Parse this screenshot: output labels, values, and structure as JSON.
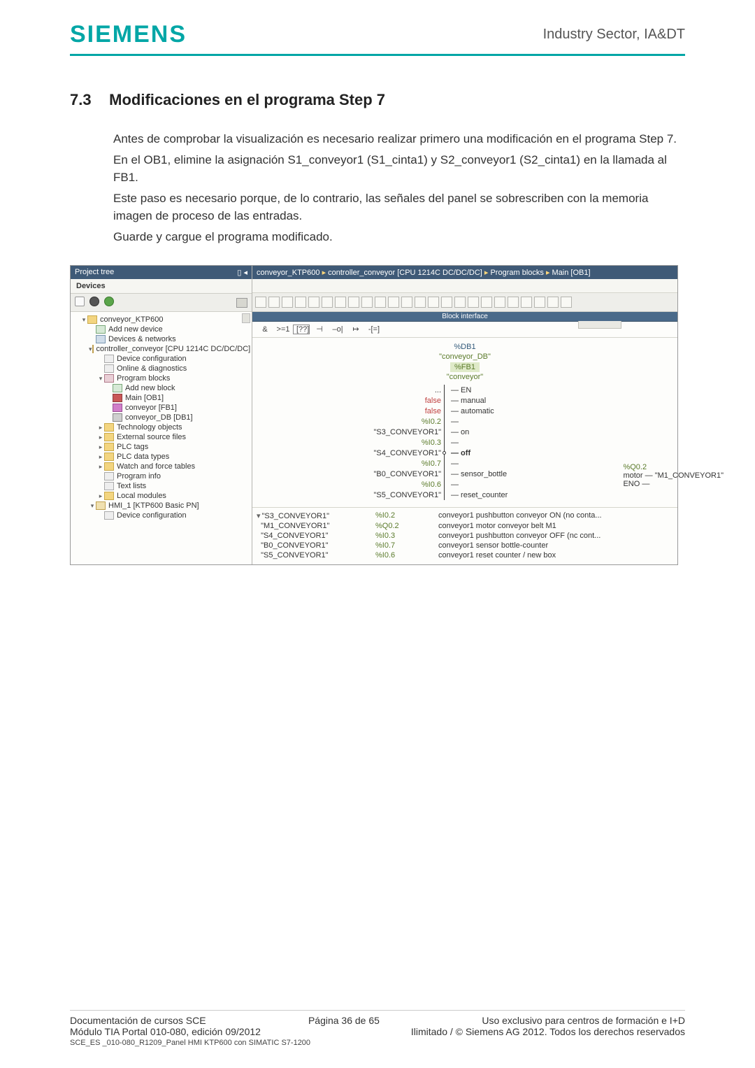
{
  "header": {
    "logo": "SIEMENS",
    "sector": "Industry Sector, IA&DT"
  },
  "section": {
    "num": "7.3",
    "title": "Modificaciones en el programa Step 7"
  },
  "body": {
    "p1": "Antes de comprobar la visualización es necesario realizar primero una modificación en el programa Step 7.",
    "p2": "En el OB1, elimine la asignación S1_conveyor1 (S1_cinta1) y S2_conveyor1 (S2_cinta1) en la llamada al FB1.",
    "p3": "Este paso es necesario porque, de lo contrario, las señales del panel se sobrescriben con la memoria imagen de proceso de las entradas.",
    "p4": "Guarde y cargue el programa modificado."
  },
  "screenshot": {
    "projectTreeTitle": "Project tree",
    "devicesTab": "Devices",
    "tree": [
      {
        "lvl": 1,
        "arrow": "▾",
        "ico": "folder",
        "label": "conveyor_KTP600"
      },
      {
        "lvl": 2,
        "arrow": "",
        "ico": "add",
        "label": "Add new device"
      },
      {
        "lvl": 2,
        "arrow": "",
        "ico": "dev",
        "label": "Devices & networks"
      },
      {
        "lvl": 2,
        "arrow": "▾",
        "ico": "plc",
        "label": "controller_conveyor [CPU 1214C DC/DC/DC]"
      },
      {
        "lvl": 3,
        "arrow": "",
        "ico": "txt",
        "label": "Device configuration"
      },
      {
        "lvl": 3,
        "arrow": "",
        "ico": "txt",
        "label": "Online & diagnostics"
      },
      {
        "lvl": 3,
        "arrow": "▾",
        "ico": "block",
        "label": "Program blocks"
      },
      {
        "lvl": 4,
        "arrow": "",
        "ico": "add",
        "label": "Add new block"
      },
      {
        "lvl": 4,
        "arrow": "",
        "ico": "main",
        "label": "Main [OB1]"
      },
      {
        "lvl": 4,
        "arrow": "",
        "ico": "fb",
        "label": "conveyor [FB1]"
      },
      {
        "lvl": 4,
        "arrow": "",
        "ico": "db",
        "label": "conveyor_DB [DB1]"
      },
      {
        "lvl": 3,
        "arrow": "▸",
        "ico": "folder",
        "label": "Technology objects"
      },
      {
        "lvl": 3,
        "arrow": "▸",
        "ico": "folder",
        "label": "External source files"
      },
      {
        "lvl": 3,
        "arrow": "▸",
        "ico": "folder",
        "label": "PLC tags"
      },
      {
        "lvl": 3,
        "arrow": "▸",
        "ico": "folder",
        "label": "PLC data types"
      },
      {
        "lvl": 3,
        "arrow": "▸",
        "ico": "folder",
        "label": "Watch and force tables"
      },
      {
        "lvl": 3,
        "arrow": "",
        "ico": "txt",
        "label": "Program info"
      },
      {
        "lvl": 3,
        "arrow": "",
        "ico": "txt",
        "label": "Text lists"
      },
      {
        "lvl": 3,
        "arrow": "▸",
        "ico": "folder",
        "label": "Local modules"
      },
      {
        "lvl": 2,
        "arrow": "▾",
        "ico": "plc",
        "label": "HMI_1 [KTP600 Basic PN]"
      },
      {
        "lvl": 3,
        "arrow": "",
        "ico": "txt",
        "label": "Device configuration"
      }
    ],
    "breadcrumb": {
      "a": "conveyor_KTP600",
      "b": "controller_conveyor [CPU 1214C DC/DC/DC]",
      "c": "Program blocks",
      "d": "Main [OB1]"
    },
    "blockInterface": "Block interface",
    "logicSymbols": [
      "&",
      ">=1",
      "[??]",
      "⊣",
      "–o|",
      "↦",
      "-[=]"
    ],
    "fbHead": {
      "db": "%DB1",
      "dbName": "\"conveyor_DB\"",
      "fb": "%FB1",
      "fbName": "\"conveyor\""
    },
    "fbPins": [
      {
        "left": "...",
        "label": "EN"
      },
      {
        "leftRed": "false",
        "label": "manual"
      },
      {
        "leftRed": "false",
        "label": "automatic"
      },
      {
        "leftGrn": "%I0.2",
        "label": ""
      },
      {
        "left": "\"S3_CONVEYOR1\"",
        "label": "on"
      },
      {
        "leftGrn": "%I0.3",
        "label": ""
      },
      {
        "left": "\"S4_CONVEYOR1\"",
        "labelBold": "off",
        "dot": true
      },
      {
        "leftGrn": "%I0.7",
        "label": ""
      },
      {
        "left": "\"B0_CONVEYOR1\"",
        "label": "sensor_bottle"
      },
      {
        "leftGrn": "%I0.6",
        "label": ""
      },
      {
        "left": "\"S5_CONVEYOR1\"",
        "label": "reset_counter"
      }
    ],
    "fbOut": {
      "q": "%Q0.2",
      "motorLab": "motor",
      "motor": "\"M1_CONVEYOR1\"",
      "eno": "ENO"
    },
    "varTable": [
      {
        "name": "\"S3_CONVEYOR1\"",
        "addr": "%I0.2",
        "desc": "conveyor1 pushbutton conveyor ON (no conta...",
        "arrow": "▾"
      },
      {
        "name": "\"M1_CONVEYOR1\"",
        "addr": "%Q0.2",
        "desc": "conveyor1 motor conveyor belt M1"
      },
      {
        "name": "\"S4_CONVEYOR1\"",
        "addr": "%I0.3",
        "desc": "conveyor1 pushbutton conveyor OFF (nc cont..."
      },
      {
        "name": "\"B0_CONVEYOR1\"",
        "addr": "%I0.7",
        "desc": "conveyor1 sensor bottle-counter"
      },
      {
        "name": "\"S5_CONVEYOR1\"",
        "addr": "%I0.6",
        "desc": "conveyor1 reset counter / new box"
      }
    ]
  },
  "footer": {
    "left1": "Documentación de cursos SCE",
    "mid1": "Página 36 de 65",
    "right1": "Uso exclusivo para centros de formación e I+D",
    "left2": "Módulo TIA Portal 010-080, edición 09/2012",
    "right2": "Ilimitado / © Siemens AG 2012. Todos los derechos reservados",
    "line3": "SCE_ES _010-080_R1209_Panel HMI KTP600 con SIMATIC S7-1200"
  }
}
